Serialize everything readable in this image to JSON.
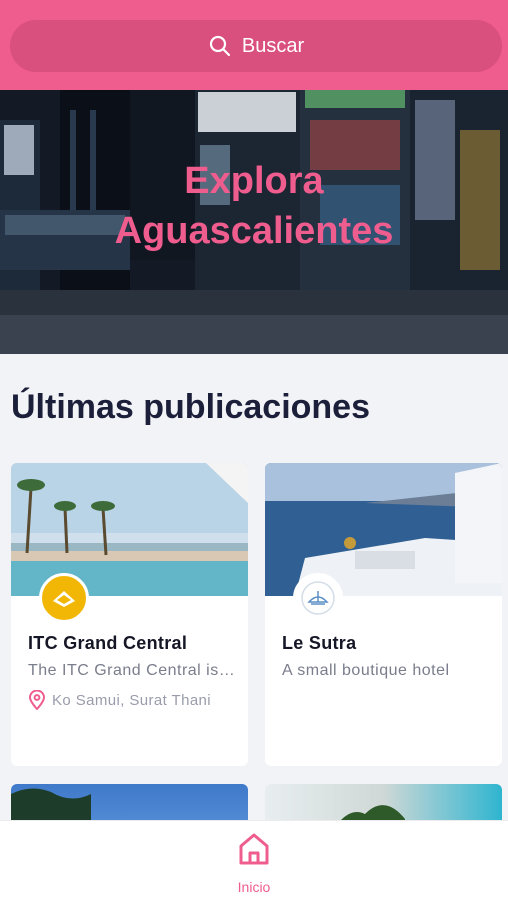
{
  "search": {
    "label": "Buscar"
  },
  "hero": {
    "line1": "Explora",
    "line2": "Aguascalientes"
  },
  "section": {
    "title": "Últimas publicaciones"
  },
  "listings": [
    {
      "name": "ITC Grand Central",
      "description": "The ITC Grand Central is a luxury hotel",
      "location": "Ko Samui, Surat Thani",
      "logo_color": "#f2b705"
    },
    {
      "name": "Le Sutra",
      "description": "A small boutique hotel",
      "location": "",
      "logo_color": "#ffffff"
    }
  ],
  "bottom_nav": {
    "home_label": "Inicio"
  },
  "colors": {
    "accent": "#ef5d8f",
    "search_bg": "#d94f7e",
    "title": "#1c1f3a"
  }
}
